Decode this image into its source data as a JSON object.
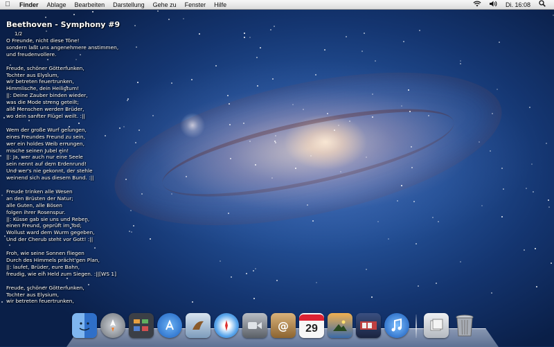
{
  "menubar": {
    "apple_icon": "apple-logo-icon",
    "app_name": "Finder",
    "menus": [
      "Ablage",
      "Bearbeiten",
      "Darstellung",
      "Gehe zu",
      "Fenster",
      "Hilfe"
    ],
    "status": {
      "wifi_icon": "wifi-icon",
      "volume_icon": "volume-icon",
      "clock": "Di. 16:08",
      "search_icon": "spotlight-icon"
    }
  },
  "lyrics": {
    "title": "Beethoven - Symphony #9",
    "page": "1/2",
    "text": "O Freunde, nicht diese Töne!\nsondern laßt uns angenehmere anstimmen,\nund freudenvollere.\n\nFreude, schöner Götterfunken,\nTochter aus Elysium,\nwir betreten feuertrunken,\nHimmlische, dein Heiligtum!\n||: Deine Zauber binden wieder,\nwas die Mode streng geteilt;\nalle Menschen werden Brüder,\nwo dein sanfter Flügel weilt. :||\n\nWem der große Wurf gelungen,\neines Freundes Freund zu sein,\nwer ein holdes Weib errungen,\nmische seinen Jubel ein!\n||: Ja, wer auch nur eine Seele\nsein nennt auf dem Erdenrund!\nUnd wer's nie gekonnt, der stehle\nweinend sich aus diesem Bund. :||\n\nFreude trinken alle Wesen\nan den Brüsten der Natur;\nalle Guten, alle Bösen\nfolgen ihrer Rosenspur.\n||: Küsse gab sie uns und Reben,\neinen Freund, geprüft im Tod;\nWollust ward dem Wurm gegeben,\nUnd der Cherub steht vor Gott! :||\n\nFroh, wie seine Sonnen fliegen\nDurch des Himmels prächt'gen Plan,\n||: laufet, Brüder, eure Bahn,\nfreudig, wie ein Held zum Siegen. :||[WS 1]\n\nFreude, schöner Götterfunken,\nTochter aus Elysium,\nwir betreten feuertrunken,"
  },
  "dock": {
    "calendar_day": "29",
    "apps": [
      {
        "name": "finder",
        "icon": "finder-icon",
        "color": "#4a8fe0"
      },
      {
        "name": "launchpad",
        "icon": "rocket-icon",
        "color": "#8a8f98"
      },
      {
        "name": "mission-control",
        "icon": "mission-control-icon",
        "color": "#3b3f46"
      },
      {
        "name": "app-store",
        "icon": "app-store-icon",
        "color": "#2d7fe0"
      },
      {
        "name": "mail",
        "icon": "mail-icon",
        "color": "#6f8fb0"
      },
      {
        "name": "safari",
        "icon": "compass-icon",
        "color": "#3a8de0"
      },
      {
        "name": "facetime",
        "icon": "camera-icon",
        "color": "#7a7f86"
      },
      {
        "name": "address-book",
        "icon": "address-book-icon",
        "color": "#b8905a"
      },
      {
        "name": "ical",
        "icon": "calendar-icon",
        "color": "#f4f4f4"
      },
      {
        "name": "iphoto",
        "icon": "photo-icon",
        "color": "#5a8ab8"
      },
      {
        "name": "photo-booth",
        "icon": "photo-booth-icon",
        "color": "#2a3a60"
      },
      {
        "name": "itunes",
        "icon": "music-note-icon",
        "color": "#1e6fd0"
      }
    ],
    "stacks": [
      {
        "name": "documents",
        "icon": "documents-stack-icon",
        "color": "#c8ccd2"
      },
      {
        "name": "trash",
        "icon": "trash-icon",
        "color": "#9aa0a8"
      }
    ]
  }
}
